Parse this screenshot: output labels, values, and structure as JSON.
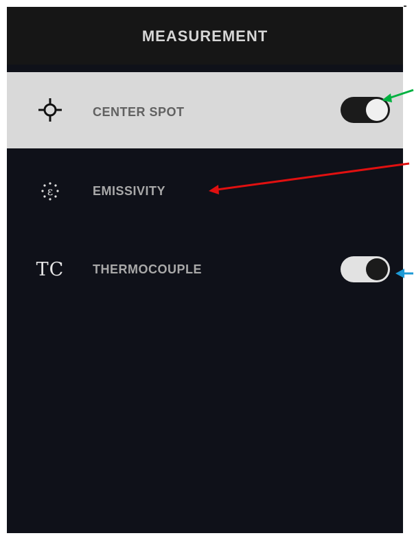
{
  "header": {
    "title": "MEASUREMENT"
  },
  "menu": {
    "items": [
      {
        "label": "CENTER SPOT",
        "icon": "crosshair-icon",
        "selected": true,
        "toggle": true,
        "toggle_on": true
      },
      {
        "label": "EMISSIVITY",
        "icon": "emissivity-icon",
        "selected": false,
        "toggle": false
      },
      {
        "label": "THERMOCOUPLE",
        "icon": "tc-icon",
        "icon_text": "TC",
        "selected": false,
        "toggle": true,
        "toggle_on": true
      }
    ]
  },
  "annotations": {
    "arrows": [
      {
        "color": "#00b140",
        "target": "center-spot-toggle"
      },
      {
        "color": "#e01010",
        "target": "emissivity-label"
      },
      {
        "color": "#1e9ad6",
        "target": "thermocouple-toggle"
      }
    ]
  },
  "colors": {
    "screen_bg": "#0f1119",
    "header_bg": "#161616",
    "selected_row_bg": "#d9d9d9",
    "label_text": "#a9a9a9",
    "selected_label_text": "#616161"
  }
}
